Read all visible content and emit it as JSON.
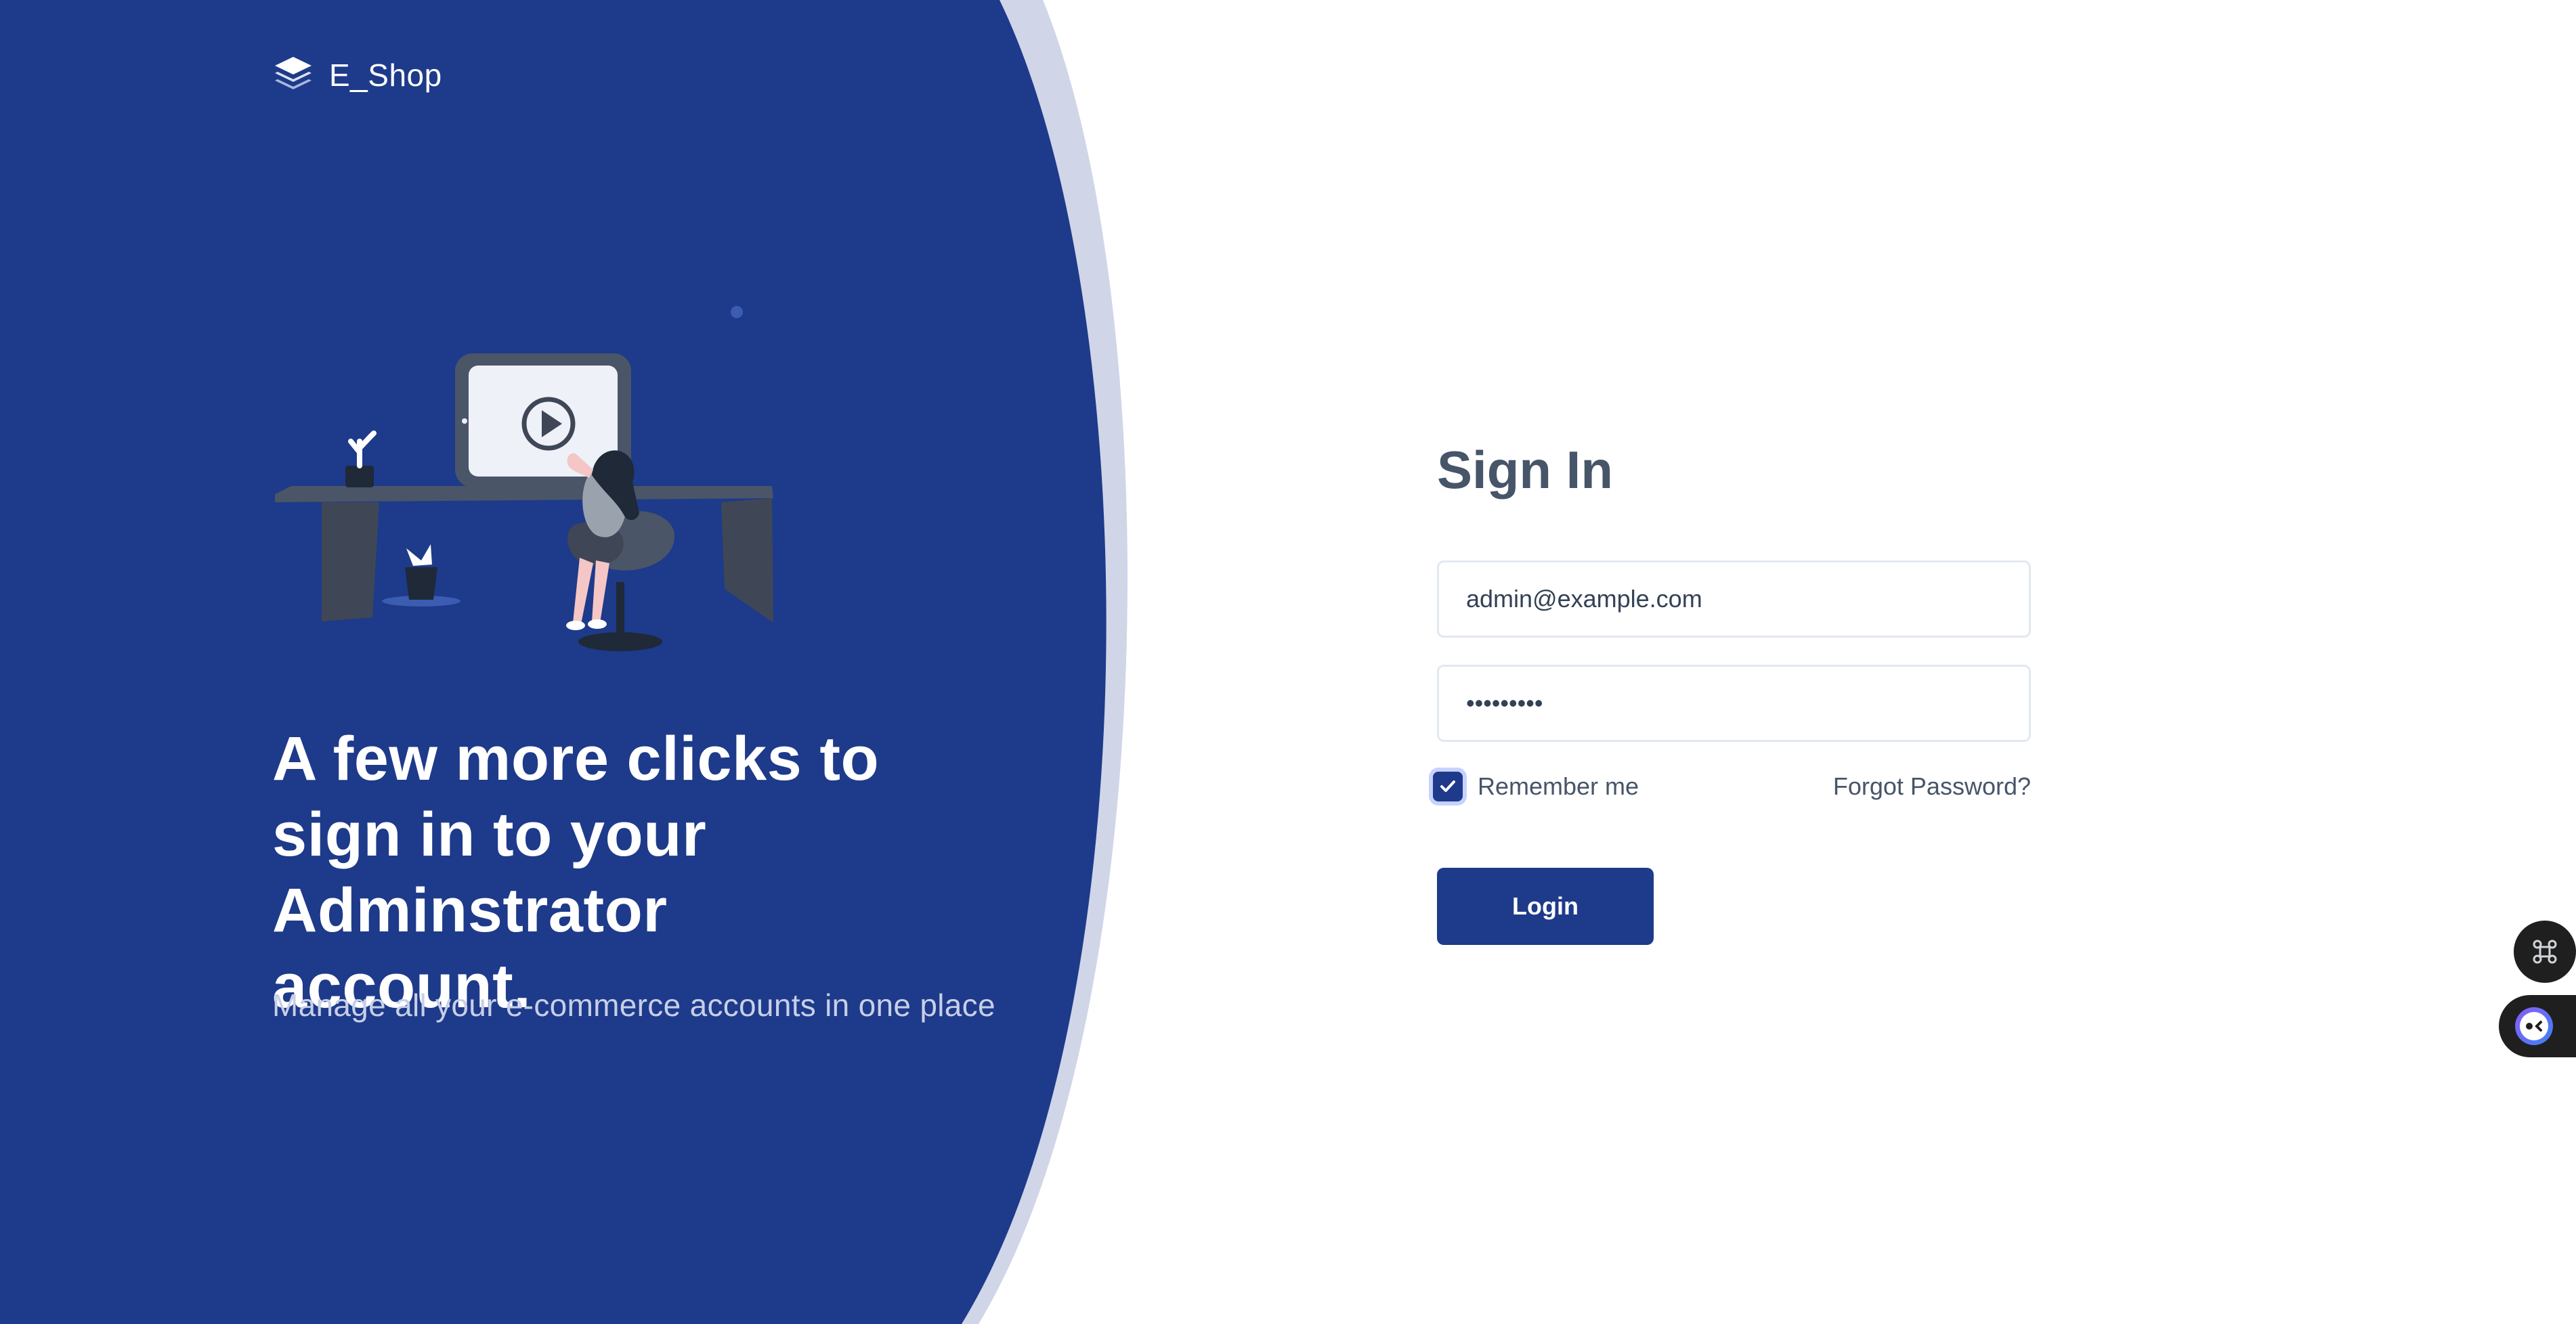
{
  "brand": {
    "name": "E_Shop",
    "logo_icon": "layers-icon",
    "primary_color": "#1e3a8a",
    "accent_stripe_color": "#d0d5e8"
  },
  "hero": {
    "headline_line1": "A few more clicks to",
    "headline_line2": "sign in to your Adminstrator",
    "headline_line3": "account.",
    "subline": "Manage all your e-commerce accounts in one place",
    "illustration": "woman-at-desk-with-monitor-illustration"
  },
  "form": {
    "title": "Sign In",
    "email_value": "admin@example.com",
    "password_value": "•••••••••",
    "remember_label": "Remember me",
    "remember_checked": true,
    "forgot_label": "Forgot Password?",
    "login_label": "Login"
  },
  "floating": {
    "command_icon": "command-icon",
    "assistant_icon": "assistant-avatar-icon"
  }
}
